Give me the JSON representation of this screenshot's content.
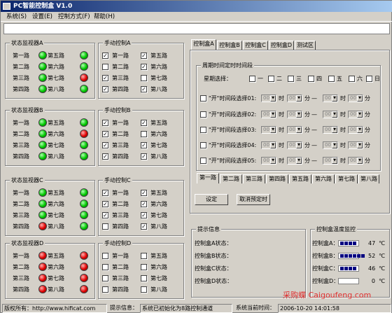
{
  "window": {
    "title": "PC智能控制盒  V1.0"
  },
  "menu": [
    "系统(S)",
    "设置(E)",
    "控制方式(F)",
    "帮助(H)"
  ],
  "monitors": [
    {
      "title": "状态监视器A",
      "labels": [
        "第一路",
        "第二路",
        "第三路",
        "第四路",
        "第五路",
        "第六路",
        "第七路",
        "第八路"
      ],
      "status": [
        "green",
        "green",
        "green",
        "green",
        "green",
        "green",
        "red",
        "green"
      ]
    },
    {
      "title": "状态监视器B",
      "labels": [
        "第一路",
        "第二路",
        "第三路",
        "第四路",
        "第五路",
        "第六路",
        "第七路",
        "第八路"
      ],
      "status": [
        "green",
        "green",
        "green",
        "green",
        "green",
        "red",
        "green",
        "green"
      ]
    },
    {
      "title": "状态监视器C",
      "labels": [
        "第一路",
        "第二路",
        "第三路",
        "第四路",
        "第五路",
        "第六路",
        "第七路",
        "第八路"
      ],
      "status": [
        "green",
        "green",
        "green",
        "red",
        "green",
        "green",
        "green",
        "green"
      ]
    },
    {
      "title": "状态监视器D",
      "labels": [
        "第一路",
        "第二路",
        "第三路",
        "第四路",
        "第五路",
        "第六路",
        "第七路",
        "第八路"
      ],
      "status": [
        "red",
        "red",
        "red",
        "red",
        "red",
        "red",
        "red",
        "red"
      ]
    }
  ],
  "manual": [
    {
      "title": "手动控制A",
      "labels": [
        "第一路",
        "第二路",
        "第三路",
        "第四路",
        "第五路",
        "第六路",
        "第七路",
        "第八路"
      ],
      "checked": [
        true,
        false,
        true,
        true,
        true,
        true,
        false,
        true
      ]
    },
    {
      "title": "手动控制B",
      "labels": [
        "第一路",
        "第二路",
        "第三路",
        "第四路",
        "第五路",
        "第六路",
        "第七路",
        "第八路"
      ],
      "checked": [
        true,
        true,
        true,
        true,
        true,
        false,
        true,
        true
      ]
    },
    {
      "title": "手动控制C",
      "labels": [
        "第一路",
        "第二路",
        "第三路",
        "第四路",
        "第五路",
        "第六路",
        "第七路",
        "第八路"
      ],
      "checked": [
        true,
        true,
        true,
        false,
        true,
        true,
        true,
        true
      ]
    },
    {
      "title": "手动控制D",
      "labels": [
        "第一路",
        "第二路",
        "第三路",
        "第四路",
        "第五路",
        "第六路",
        "第七路",
        "第八路"
      ],
      "checked": [
        false,
        false,
        false,
        false,
        false,
        false,
        false,
        false
      ]
    }
  ],
  "tabs": [
    "控制盒A",
    "控制盒B",
    "控制盒C",
    "控制盒D",
    "测试区"
  ],
  "schedule": {
    "group_title": "周期时间定时时间段",
    "weekday_label": "星期选择：",
    "weekdays": [
      "一",
      "二",
      "三",
      "四",
      "五",
      "六",
      "日"
    ],
    "rows": [
      "\"开\"时间段选择01:",
      "\"开\"时间段选择02:",
      "\"开\"时间段选择03:",
      "\"开\"时间段选择04:",
      "\"开\"时间段选择05:"
    ],
    "hour_unit": "时",
    "min_unit": "分",
    "sep": "—",
    "val": "00"
  },
  "channel_tabs": [
    "第一路",
    "第二路",
    "第三路",
    "第四路",
    "第五路",
    "第六路",
    "第七路",
    "第八路"
  ],
  "buttons": {
    "set": "设定",
    "cancel": "取消预定时"
  },
  "info": {
    "title": "提示信息",
    "lines": [
      "控制盒A状态：",
      "控制盒B状态：",
      "控制盒C状态：",
      "控制盒D状态："
    ]
  },
  "temp": {
    "title": "控制盒温度监控",
    "rows": [
      {
        "label": "控制盒A：",
        "value": "47",
        "unit": "℃",
        "level": 0.4
      },
      {
        "label": "控制盒B：",
        "value": "52",
        "unit": "℃",
        "level": 0.55
      },
      {
        "label": "控制盒C：",
        "value": "46",
        "unit": "℃",
        "level": 0.4
      },
      {
        "label": "控制盒D：",
        "value": "0",
        "unit": "℃",
        "level": 0
      }
    ]
  },
  "status": {
    "copyright": "版权所有：http://www.hificat.com",
    "info_label": "提示信息：",
    "info": "系统已初始化为8路控制通道",
    "time_label": "系统当前时间：",
    "time": "2006-10-20 14:01:58"
  },
  "watermark": "采购蝶 Caigoufeng.com"
}
